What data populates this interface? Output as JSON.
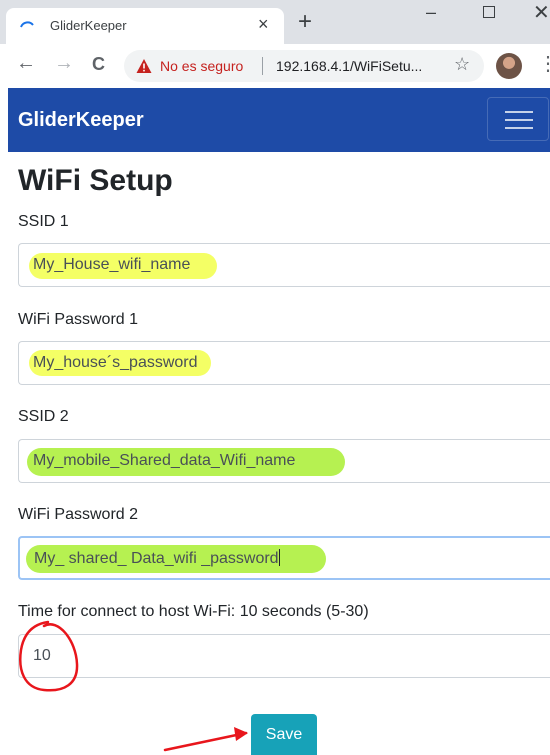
{
  "browser": {
    "tab_title": "GliderKeeper",
    "tab_close": "×",
    "new_tab": "+",
    "window_minimize": "–",
    "window_close": "✕",
    "back": "←",
    "forward": "→",
    "reload": "C",
    "security_text": "No es seguro",
    "url": "192.168.4.1/WiFiSetu...",
    "star": "☆",
    "menu": "⋮"
  },
  "navbar": {
    "brand": "GliderKeeper"
  },
  "page": {
    "title": "WiFi Setup",
    "fields": [
      {
        "label": "SSID 1",
        "value": "My_House_wifi_name"
      },
      {
        "label": "WiFi Password 1",
        "value": "My_house´s_password"
      },
      {
        "label": "SSID 2",
        "value": "My_mobile_Shared_data_Wifi_name"
      },
      {
        "label": "WiFi Password 2",
        "value": "My_ shared_ Data_wifi _password"
      },
      {
        "label": "Time for connect to host Wi-Fi: 10 seconds (5-30)",
        "value": "10"
      }
    ],
    "save_label": "Save"
  },
  "annotations": {
    "highlight_yellow": "#f3ff54",
    "highlight_green": "#aef03e",
    "marker_red": "#e8161c"
  },
  "colors": {
    "navbar": "#1e4ba7",
    "save_button": "#17a2b8",
    "insecure": "#c5221f"
  }
}
